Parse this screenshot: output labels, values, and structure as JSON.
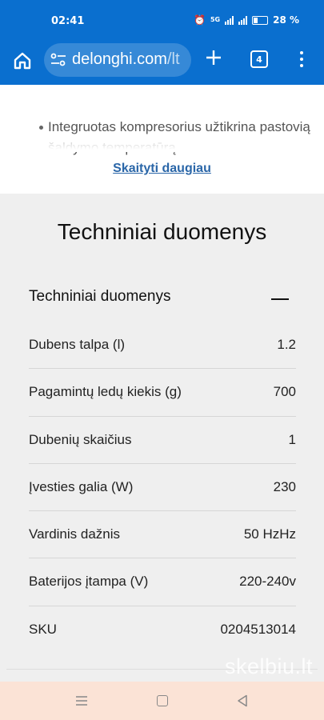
{
  "status_bar": {
    "time": "02:41",
    "network_label": "5G",
    "battery_percent": "28 %"
  },
  "browser": {
    "url_main": "delonghi.com",
    "url_rest": "/lt",
    "tab_count": "4",
    "icons": [
      "home-icon",
      "site-settings-icon",
      "plus-icon",
      "tabs-icon",
      "more-vert-icon"
    ]
  },
  "description": {
    "bullet_text": "Integruotas kompresorius užtikrina pastovią šaldymo temperatūrą",
    "read_more": "Skaityti daugiau"
  },
  "specs": {
    "heading": "Techniniai duomenys",
    "accordion_title": "Techniniai duomenys",
    "accordion_icon": "collapse-minus-icon",
    "rows": [
      {
        "label": "Dubens talpa (l)",
        "value": "1.2"
      },
      {
        "label": "Pagamintų ledų kiekis (g)",
        "value": "700"
      },
      {
        "label": "Dubenių skaičius",
        "value": "1"
      },
      {
        "label": "Įvesties galia (W)",
        "value": "230"
      },
      {
        "label": "Vardinis dažnis",
        "value": "50 HzHz"
      },
      {
        "label": "Baterijos įtampa (V)",
        "value": "220-240v"
      },
      {
        "label": "SKU",
        "value": "0204513014"
      }
    ]
  },
  "watermark": "skelbiu.lt",
  "colors": {
    "browser_bar": "#0a6fcf",
    "link": "#2a66a8",
    "page_bg": "#efefef",
    "nav_bar": "#fbe3d6"
  }
}
